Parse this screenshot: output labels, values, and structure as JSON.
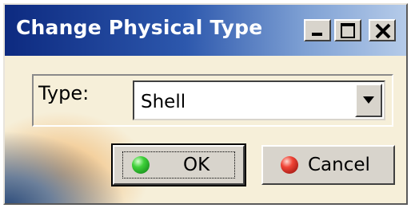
{
  "window": {
    "title": "Change Physical Type",
    "controls": {
      "minimize_icon": "minimize-icon",
      "maximize_icon": "maximize-icon",
      "close_icon": "close-icon"
    }
  },
  "form": {
    "type_label": "Type:",
    "type_value": "Shell",
    "dropdown_icon": "chevron-down-icon"
  },
  "buttons": {
    "ok_label": "OK",
    "ok_icon": "green-ball-icon",
    "cancel_label": "Cancel",
    "cancel_icon": "red-ball-icon"
  },
  "colors": {
    "titlebar_start": "#0d2a80",
    "titlebar_end": "#b5cbe9",
    "dialog_bg": "#f6efd9",
    "button_face": "#d8d4cc"
  }
}
